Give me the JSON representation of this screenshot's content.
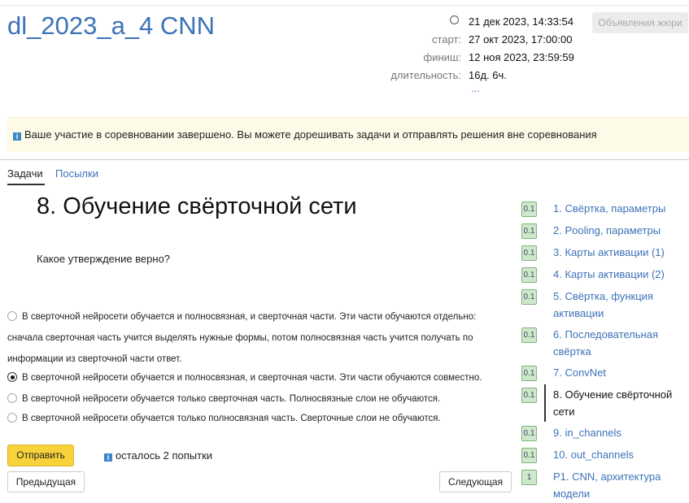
{
  "header": {
    "title": "dl_2023_a_4 CNN",
    "now": "21 дек 2023, 14:33:54",
    "start_label": "старт:",
    "start": "27 окт 2023, 17:00:00",
    "finish_label": "финиш:",
    "finish": "12 ноя 2023, 23:59:59",
    "duration_label": "длительность:",
    "duration": "16д. 6ч.",
    "more": "...",
    "jury_button": "Объявления жюри"
  },
  "notice": "Ваше участие в соревновании завершено. Вы можете дорешивать задачи и отправлять решения вне соревнования",
  "tabs": [
    "Задачи",
    "Посылки"
  ],
  "problem": {
    "title": "8. Обучение свёрточной сети",
    "question": "Какое утверждение верно?",
    "options": [
      {
        "text": "В сверточной нейросети обучается и полносвязная, и сверточная части. Эти части обучаются отдельно: сначала сверточная часть учится выделять нужные формы, потом полносвязная часть учится получать по информации из сверточной части ответ.",
        "selected": false
      },
      {
        "text": "В сверточной нейросети обучается и полносвязная, и сверточная части. Эти части обучаются совместно.",
        "selected": true
      },
      {
        "text": "В сверточной нейросети обучается только сверточная часть. Полносвязные слои не обучаются.",
        "selected": false
      },
      {
        "text": "В сверточной нейросети обучается только полносвязная часть. Сверточные слои не обучаются.",
        "selected": false
      }
    ],
    "submit": "Отправить",
    "attempts": "осталось 2 попытки",
    "prev": "Предыдущая",
    "next": "Следующая"
  },
  "problems": [
    {
      "score": "0.1",
      "name": "1. Свёртка, параметры"
    },
    {
      "score": "0.1",
      "name": "2. Pooling, параметры"
    },
    {
      "score": "0.1",
      "name": "3. Карты активации (1)"
    },
    {
      "score": "0.1",
      "name": "4. Карты активации (2)"
    },
    {
      "score": "0.1",
      "name": "5. Свёртка, функция активации"
    },
    {
      "score": "0.1",
      "name": "6. Последовательная свёртка"
    },
    {
      "score": "0.1",
      "name": "7. ConvNet"
    },
    {
      "score": "0.1",
      "name": "8. Обучение свёрточной сети",
      "current": true
    },
    {
      "score": "0.1",
      "name": "9. in_channels"
    },
    {
      "score": "0.1",
      "name": "10. out_channels"
    },
    {
      "score": "1",
      "name": "P1. CNN, архитектура модели"
    }
  ]
}
